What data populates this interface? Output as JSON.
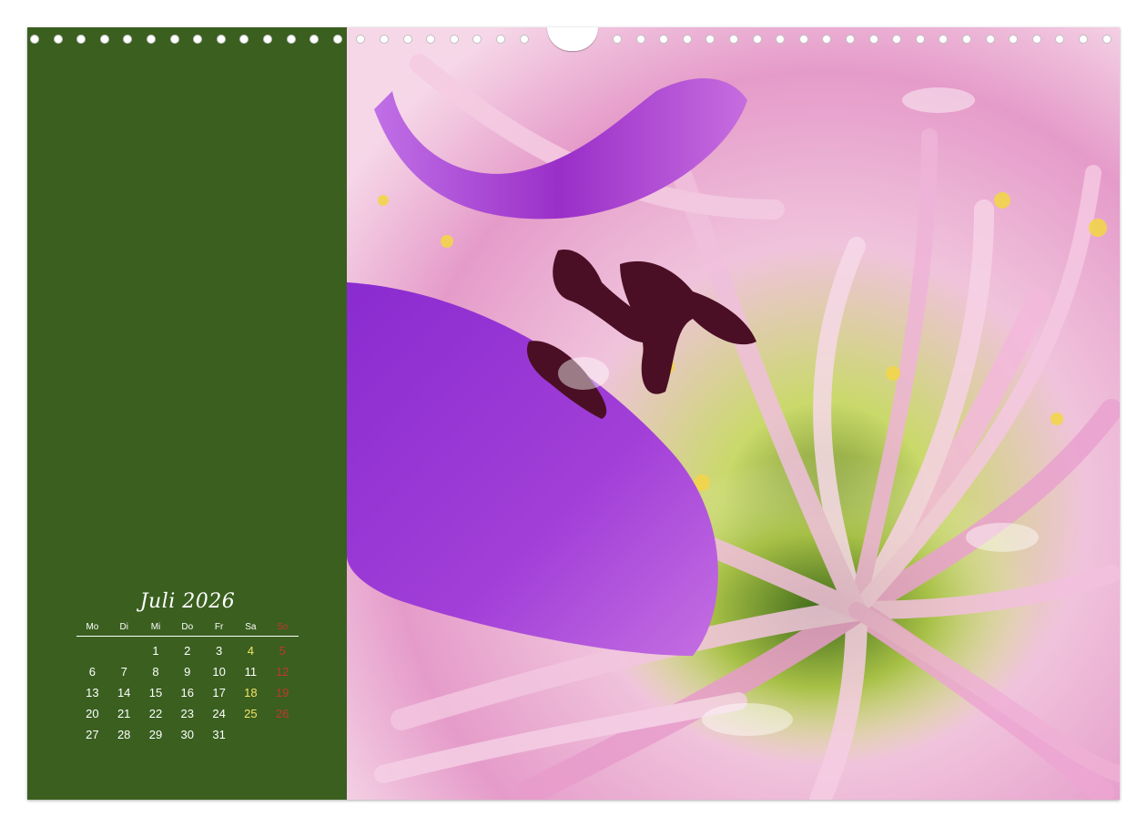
{
  "calendar": {
    "title": "Juli 2026",
    "weekdays": [
      "Mo",
      "Di",
      "Mi",
      "Do",
      "Fr",
      "Sa",
      "So"
    ],
    "weeks": [
      [
        "",
        "",
        "1",
        "2",
        "3",
        "4",
        "5"
      ],
      [
        "6",
        "7",
        "8",
        "9",
        "10",
        "11",
        "12"
      ],
      [
        "13",
        "14",
        "15",
        "16",
        "17",
        "18",
        "19"
      ],
      [
        "20",
        "21",
        "22",
        "23",
        "24",
        "25",
        "26"
      ],
      [
        "27",
        "28",
        "29",
        "30",
        "31",
        "",
        ""
      ]
    ]
  },
  "colors": {
    "panel": "#3a5f1f",
    "text": "#ffffff",
    "saturday": "#f5e36b",
    "sunday": "#c0392b"
  },
  "photo": {
    "subject": "flower-macro-photo"
  }
}
